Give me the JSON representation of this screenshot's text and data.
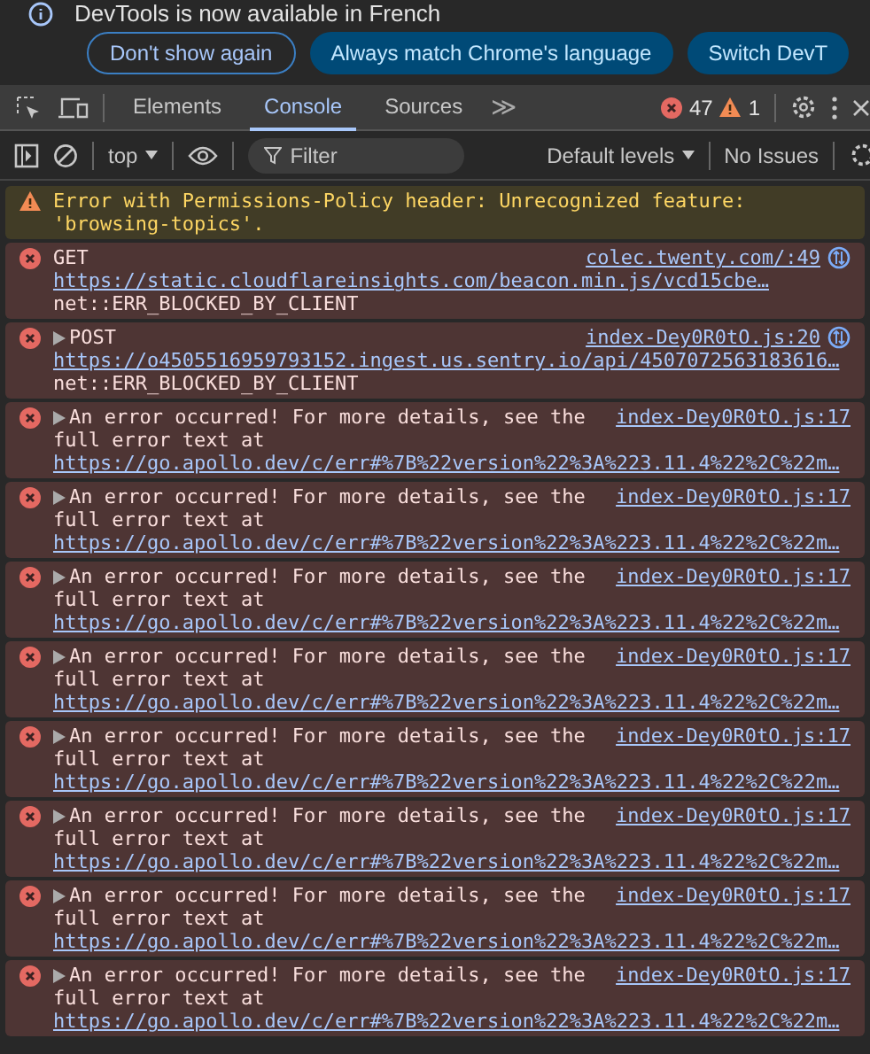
{
  "banner": {
    "message": "DevTools is now available in French",
    "buttons": [
      {
        "label": "Don't show again",
        "kind": "outline"
      },
      {
        "label": "Always match Chrome's language",
        "kind": "filled"
      },
      {
        "label": "Switch DevT",
        "kind": "filled"
      }
    ]
  },
  "tabs": [
    {
      "label": "Elements",
      "selected": false
    },
    {
      "label": "Console",
      "selected": true
    },
    {
      "label": "Sources",
      "selected": false
    }
  ],
  "more_tabs": "≫",
  "counts": {
    "errors": "47",
    "warnings": "1"
  },
  "toolbar": {
    "context": "top",
    "filter": {
      "placeholder": "Filter"
    },
    "levels": "Default levels",
    "issues": "No Issues"
  },
  "messages": [
    {
      "kind": "warning",
      "expandable": false,
      "text": "Error with Permissions-Policy header: Unrecognized feature: 'browsing-topics'."
    },
    {
      "kind": "error",
      "expandable": false,
      "network": true,
      "text": "GET",
      "source": "colec.twenty.com/:49",
      "lines": [
        {
          "kind": "link",
          "text": "https://static.cloudflareinsights.com/beacon.min.js/vcd15cbe…"
        },
        {
          "kind": "text",
          "text": "net::ERR_BLOCKED_BY_CLIENT"
        }
      ]
    },
    {
      "kind": "error",
      "expandable": true,
      "network": true,
      "text": "POST",
      "source": "index-Dey0R0tO.js:20",
      "lines": [
        {
          "kind": "link",
          "text": "https://o4505516959793152.ingest.us.sentry.io/api/4507072563183616…"
        },
        {
          "kind": "text",
          "text": "net::ERR_BLOCKED_BY_CLIENT"
        }
      ]
    },
    {
      "kind": "error",
      "expandable": true,
      "network": false,
      "text": "An error occurred! For more details, see the",
      "source": "index-Dey0R0tO.js:17",
      "lines": [
        {
          "kind": "text",
          "text": "full error text at"
        },
        {
          "kind": "link",
          "text": "https://go.apollo.dev/c/err#%7B%22version%22%3A%223.11.4%22%2C%22m…"
        }
      ]
    },
    {
      "kind": "error",
      "expandable": true,
      "network": false,
      "text": "An error occurred! For more details, see the",
      "source": "index-Dey0R0tO.js:17",
      "lines": [
        {
          "kind": "text",
          "text": "full error text at"
        },
        {
          "kind": "link",
          "text": "https://go.apollo.dev/c/err#%7B%22version%22%3A%223.11.4%22%2C%22m…"
        }
      ]
    },
    {
      "kind": "error",
      "expandable": true,
      "network": false,
      "text": "An error occurred! For more details, see the",
      "source": "index-Dey0R0tO.js:17",
      "lines": [
        {
          "kind": "text",
          "text": "full error text at"
        },
        {
          "kind": "link",
          "text": "https://go.apollo.dev/c/err#%7B%22version%22%3A%223.11.4%22%2C%22m…"
        }
      ]
    },
    {
      "kind": "error",
      "expandable": true,
      "network": false,
      "text": "An error occurred! For more details, see the",
      "source": "index-Dey0R0tO.js:17",
      "lines": [
        {
          "kind": "text",
          "text": "full error text at"
        },
        {
          "kind": "link",
          "text": "https://go.apollo.dev/c/err#%7B%22version%22%3A%223.11.4%22%2C%22m…"
        }
      ]
    },
    {
      "kind": "error",
      "expandable": true,
      "network": false,
      "text": "An error occurred! For more details, see the",
      "source": "index-Dey0R0tO.js:17",
      "lines": [
        {
          "kind": "text",
          "text": "full error text at"
        },
        {
          "kind": "link",
          "text": "https://go.apollo.dev/c/err#%7B%22version%22%3A%223.11.4%22%2C%22m…"
        }
      ]
    },
    {
      "kind": "error",
      "expandable": true,
      "network": false,
      "text": "An error occurred! For more details, see the",
      "source": "index-Dey0R0tO.js:17",
      "lines": [
        {
          "kind": "text",
          "text": "full error text at"
        },
        {
          "kind": "link",
          "text": "https://go.apollo.dev/c/err#%7B%22version%22%3A%223.11.4%22%2C%22m…"
        }
      ]
    },
    {
      "kind": "error",
      "expandable": true,
      "network": false,
      "text": "An error occurred! For more details, see the",
      "source": "index-Dey0R0tO.js:17",
      "lines": [
        {
          "kind": "text",
          "text": "full error text at"
        },
        {
          "kind": "link",
          "text": "https://go.apollo.dev/c/err#%7B%22version%22%3A%223.11.4%22%2C%22m…"
        }
      ]
    },
    {
      "kind": "error",
      "expandable": true,
      "network": false,
      "text": "An error occurred! For more details, see the",
      "source": "index-Dey0R0tO.js:17",
      "lines": [
        {
          "kind": "text",
          "text": "full error text at"
        },
        {
          "kind": "link",
          "text": "https://go.apollo.dev/c/err#%7B%22version%22%3A%223.11.4%22%2C%22m…"
        }
      ]
    }
  ]
}
